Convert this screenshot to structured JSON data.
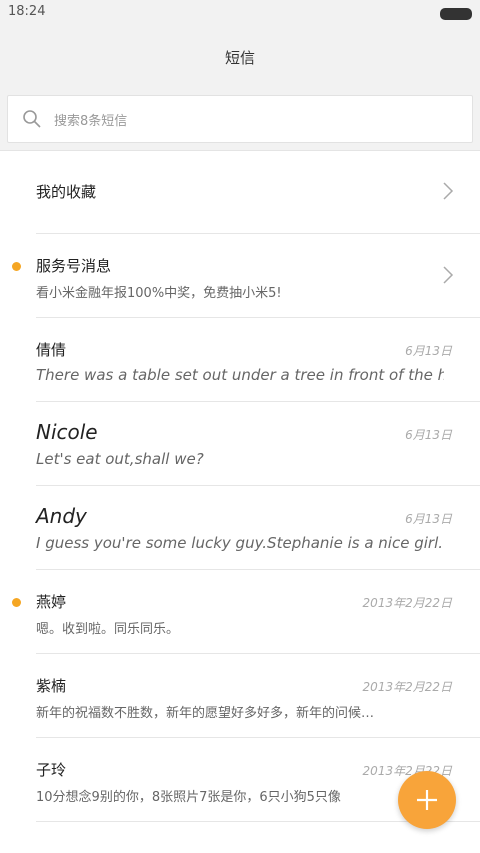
{
  "status_bar": {
    "time": "18:24"
  },
  "header": {
    "title": "短信"
  },
  "search": {
    "placeholder": "搜索8条短信"
  },
  "favorites": {
    "label": "我的收藏"
  },
  "service": {
    "title": "服务号消息",
    "preview": "看小米金融年报100%中奖，免费抽小米5!",
    "unread": true
  },
  "conversations": [
    {
      "name": "倩倩",
      "preview": "There was a table set out under a tree in front of the hous",
      "date": "6月13日",
      "unread": false
    },
    {
      "name": "Nicole",
      "preview": "Let's eat out,shall we?",
      "date": "6月13日",
      "unread": false
    },
    {
      "name": "Andy",
      "preview": "I guess you're some lucky guy.Stephanie is a nice girl.",
      "date": "6月13日",
      "unread": false
    },
    {
      "name": "燕婷",
      "preview": "嗯。收到啦。同乐同乐。",
      "date": "2013年2月22日",
      "unread": true
    },
    {
      "name": "紫楠",
      "preview": "新年的祝福数不胜数，新年的愿望好多好多，新年的问候…",
      "date": "2013年2月22日",
      "unread": false
    },
    {
      "name": "子玲",
      "preview": "10分想念9别的你，8张照片7张是你，6只小狗5只像",
      "date": "2013年2月22日",
      "unread": false
    }
  ],
  "colors": {
    "accent": "#f8a43a",
    "unread_dot": "#f5a623"
  },
  "icons": {
    "search": "search-icon",
    "chevron": "chevron-right-icon",
    "compose": "plus-icon"
  }
}
